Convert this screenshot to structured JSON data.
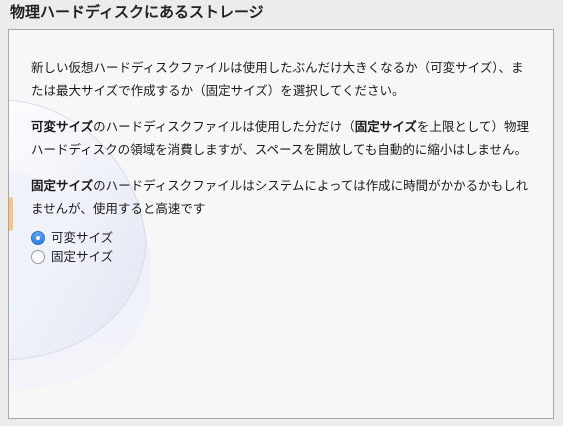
{
  "page": {
    "title": "物理ハードディスクにあるストレージ"
  },
  "intro": {
    "text": "新しい仮想ハードディスクファイルは使用したぶんだけ大きくなるか（可変サイズ）、または最大サイズで作成するか（固定サイズ）を選択してください。"
  },
  "dynamic_para": {
    "b1": "可変サイズ",
    "t1": "のハードディスクファイルは使用した分だけ（",
    "b2": "固定サイズ",
    "t2": "を上限として）物理ハードディスクの領域を消費しますが、スペースを開放しても自動的に縮小はしません。"
  },
  "fixed_para": {
    "b1": "固定サイズ",
    "t1": "のハードディスクファイルはシステムによっては作成に時間がかかるかもしれませんが、使用すると高速です"
  },
  "options": [
    {
      "label": "可変サイズ",
      "selected": true
    },
    {
      "label": "固定サイズ",
      "selected": false
    }
  ],
  "colors": {
    "radio_selected": "#2f7fe6",
    "panel_bg": "#f7f7f7",
    "window_bg": "#ececec"
  }
}
